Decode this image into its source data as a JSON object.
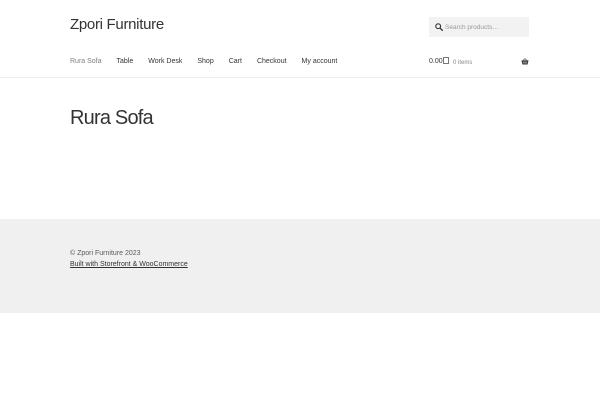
{
  "header": {
    "site_title": "Zpori Furniture",
    "search_placeholder": "Search products…"
  },
  "nav": {
    "items": [
      {
        "label": "Rura Sofa",
        "current": true
      },
      {
        "label": "Table"
      },
      {
        "label": "Work Desk"
      },
      {
        "label": "Shop"
      },
      {
        "label": "Cart"
      },
      {
        "label": "Checkout"
      },
      {
        "label": "My account"
      }
    ]
  },
  "cart": {
    "amount": "0.00",
    "count": "0 items"
  },
  "main": {
    "page_title": "Rura Sofa"
  },
  "footer": {
    "copyright": "© Zpori Furniture 2023",
    "credit": "Built with Storefront & WooCommerce"
  },
  "colors": {
    "text": "#333333",
    "muted": "#7f7f7f",
    "footer_bg": "#f0f0f0",
    "search_bg": "#f2f2f2"
  },
  "icons": {
    "search": "search-icon",
    "basket": "basket-icon",
    "amount": "currency-icon"
  }
}
